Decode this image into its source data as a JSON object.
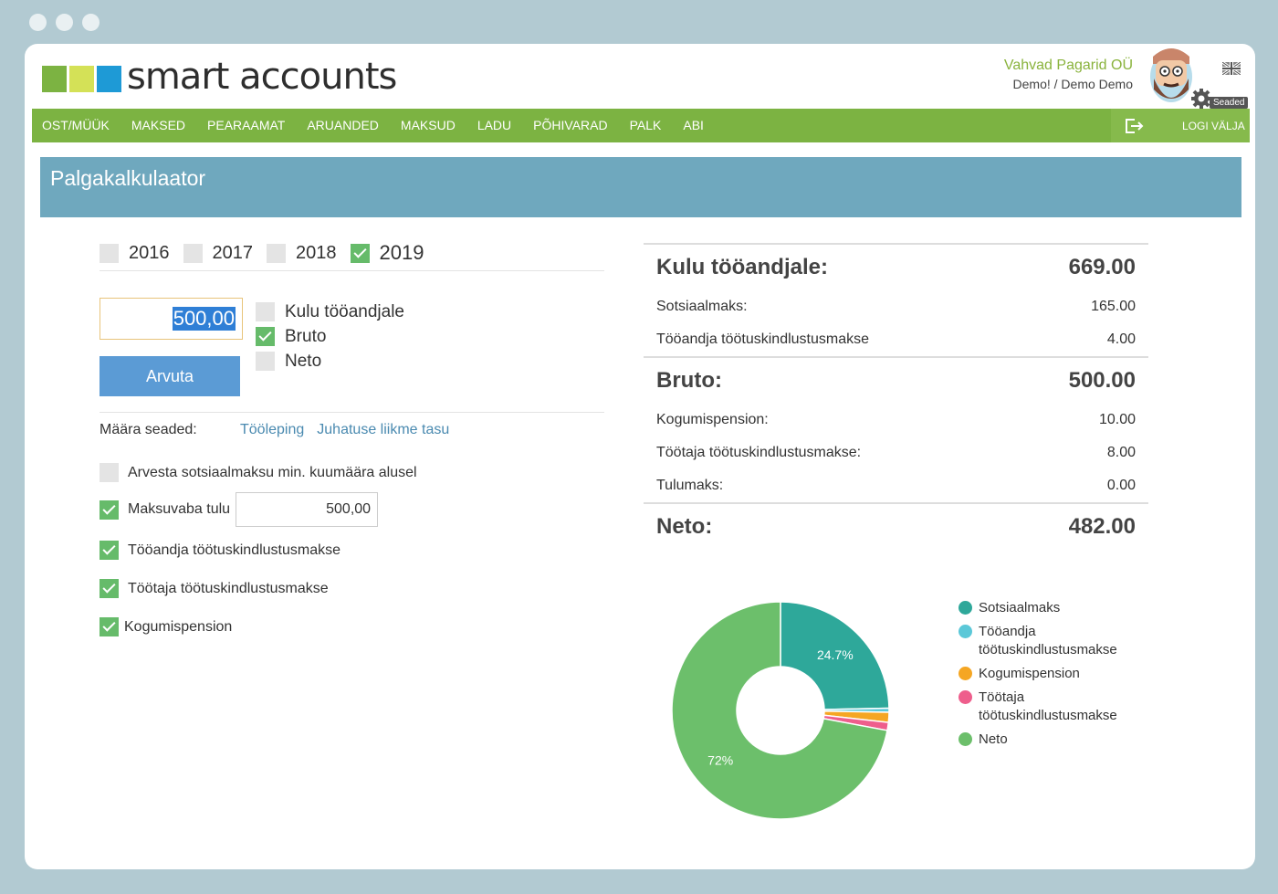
{
  "app": {
    "logo_text": "smart accounts",
    "logo_colors": [
      "#7cb342",
      "#d4e157",
      "#1e9ad6"
    ],
    "company_name": "Vahvad Pagarid OÜ",
    "user": "Demo! / Demo Demo",
    "settings_label": "Seaded",
    "language_icon": "uk-flag-icon"
  },
  "nav": {
    "items": [
      "OST/MÜÜK",
      "MAKSED",
      "PEARAAMAT",
      "ARUANDED",
      "MAKSUD",
      "LADU",
      "PÕHIVARAD",
      "PALK",
      "ABI"
    ],
    "logout_label": "LOGI VÄLJA",
    "logout_icon": "logout-icon",
    "color": "#7cb342"
  },
  "page": {
    "title": "Palgakalkulaator",
    "title_bg": "#6fa8be"
  },
  "years": [
    {
      "label": "2016",
      "checked": false
    },
    {
      "label": "2017",
      "checked": false
    },
    {
      "label": "2018",
      "checked": false
    },
    {
      "label": "2019",
      "checked": true
    }
  ],
  "calculator": {
    "amount_value": "500,00",
    "calculate_label": "Arvuta",
    "modes": [
      {
        "label": "Kulu tööandjale",
        "checked": false
      },
      {
        "label": "Bruto",
        "checked": true
      },
      {
        "label": "Neto",
        "checked": false
      }
    ]
  },
  "presets": {
    "label": "Määra seaded:",
    "links": [
      "Tööleping",
      "Juhatuse liikme tasu"
    ]
  },
  "options": {
    "social_min": {
      "label": "Arvesta sotsiaalmaksu min. kuumäära alusel",
      "checked": false
    },
    "tax_free": {
      "label": "Maksuvaba tulu",
      "checked": true,
      "value": "500,00"
    },
    "employer_unemp": {
      "label": "Tööandja töötuskindlustusmakse",
      "checked": true
    },
    "employee_unemp": {
      "label": "Töötaja töötuskindlustusmakse",
      "checked": true
    },
    "pension": {
      "label": "Kogumispension",
      "checked": true
    }
  },
  "summary": {
    "employer_cost_label": "Kulu tööandjale:",
    "employer_cost": "669.00",
    "social_tax_label": "Sotsiaalmaks:",
    "social_tax": "165.00",
    "employer_unemp_label": "Tööandja töötuskindlustusmakse",
    "employer_unemp": "4.00",
    "gross_label": "Bruto:",
    "gross": "500.00",
    "pension_label": "Kogumispension:",
    "pension": "10.00",
    "employee_unemp_label": "Töötaja töötuskindlustusmakse:",
    "employee_unemp": "8.00",
    "income_tax_label": "Tulumaks:",
    "income_tax": "0.00",
    "net_label": "Neto:",
    "net": "482.00"
  },
  "chart_data": {
    "type": "pie",
    "donut": true,
    "legend_position": "right",
    "series": [
      {
        "name": "Sotsiaalmaks",
        "value": 165.0,
        "color": "#2ea89a",
        "label": "24.7%"
      },
      {
        "name": "Tööandja töötuskindlustusmakse",
        "value": 4.0,
        "color": "#5bc8d8",
        "label": ""
      },
      {
        "name": "Kogumispension",
        "value": 10.0,
        "color": "#f5a623",
        "label": ""
      },
      {
        "name": "Töötaja töötuskindlustusmakse",
        "value": 8.0,
        "color": "#ee5e8c",
        "label": ""
      },
      {
        "name": "Neto",
        "value": 482.0,
        "color": "#6cbf6b",
        "label": "72%"
      }
    ]
  }
}
